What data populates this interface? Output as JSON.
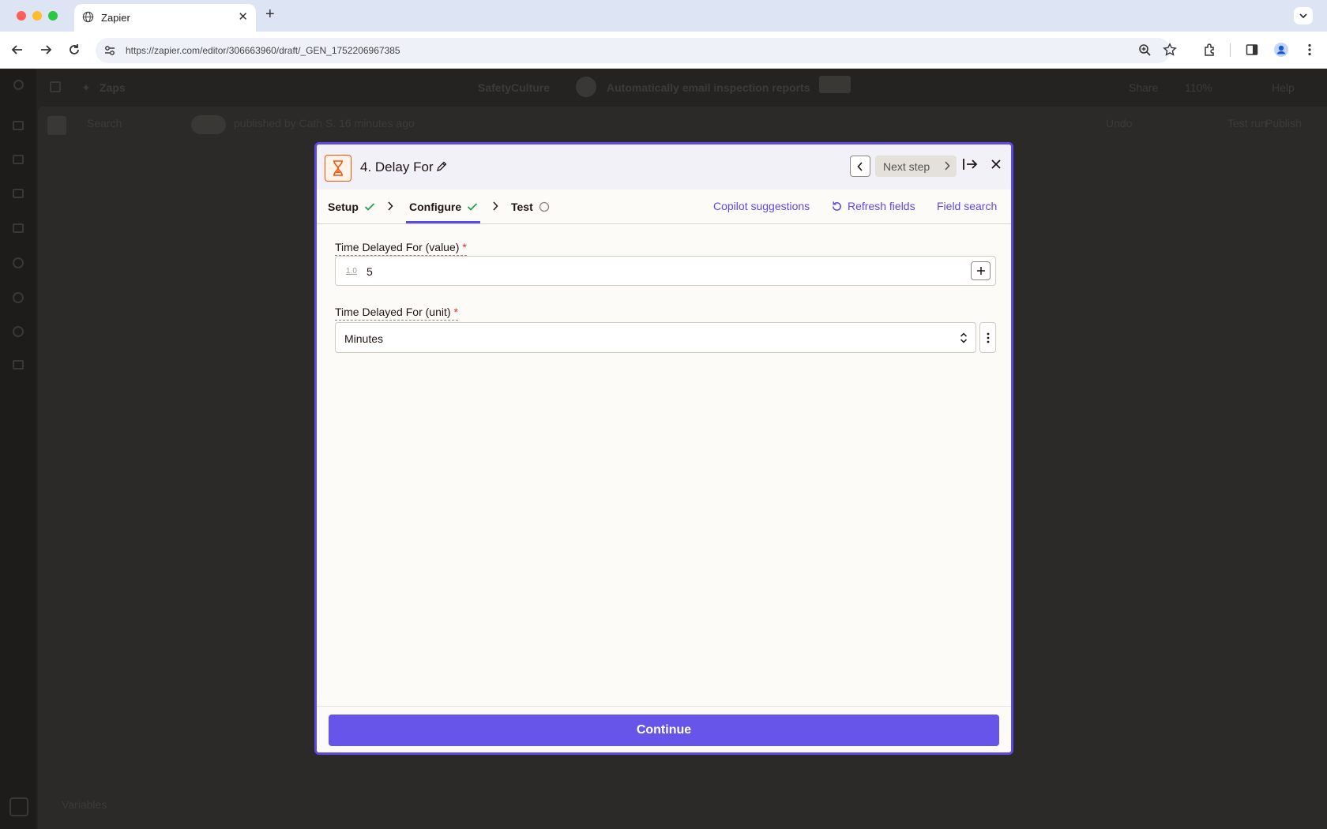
{
  "browser": {
    "tab_title": "Zapier",
    "url": "https://zapier.com/editor/306663960/draft/_GEN_1752206967385"
  },
  "background": {
    "breadcrumb_app": "SafetyCulture",
    "breadcrumb_zap": "Automatically email inspection reports",
    "nav_label": "Zaps",
    "share": "Share",
    "zoom": "110%",
    "help": "Help",
    "undo": "Undo",
    "test_run": "Test run",
    "publish": "Publish",
    "search": "Search",
    "published_by": "published by Cath S. 16 minutes ago",
    "variables": "Variables"
  },
  "modal": {
    "step_title": "4. Delay For",
    "next_step": "Next step",
    "tabs": [
      {
        "label": "Setup",
        "status": "complete"
      },
      {
        "label": "Configure",
        "status": "complete"
      },
      {
        "label": "Test",
        "status": "pending"
      }
    ],
    "actions": {
      "copilot": "Copilot suggestions",
      "refresh": "Refresh fields",
      "field_search": "Field search"
    },
    "fields": {
      "value_label": "Time Delayed For (value)",
      "value_type_icon": "1.0",
      "value": "5",
      "unit_label": "Time Delayed For (unit)",
      "unit": "Minutes",
      "required_mark": "*"
    },
    "continue": "Continue"
  },
  "colors": {
    "accent": "#5d4ae3",
    "button": "#6655e8",
    "check": "#1f9e4f",
    "step_icon": "#ff4f00",
    "required": "#e0301e"
  }
}
